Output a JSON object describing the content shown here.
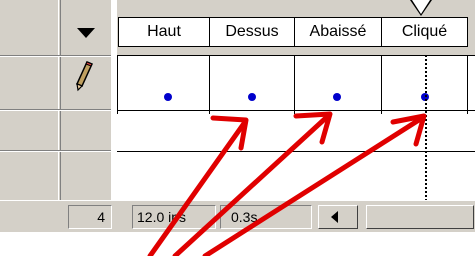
{
  "timeline": {
    "frame_labels": [
      "Haut",
      "Dessus",
      "Abaissé",
      "Cliqué"
    ]
  },
  "status": {
    "frame_number": "4",
    "frame_rate": "12.0 ips",
    "elapsed_time": "0.3s"
  },
  "colors": {
    "chrome": "#d4d0c8",
    "dot": "#0000cc",
    "annotation_arrow": "#e00000"
  },
  "icons": {
    "dropdown": "triangle-down-icon",
    "edit": "pencil-icon",
    "scroll_left": "scroll-left-arrow-icon"
  }
}
